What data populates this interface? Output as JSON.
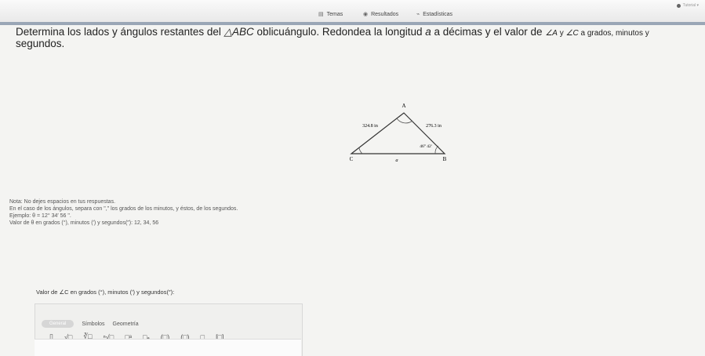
{
  "nav": {
    "temas": "Temas",
    "resultados": "Resultados",
    "estadisticas": "Estadísticas",
    "user": "Tutorial ▾"
  },
  "question": {
    "line1_a": "Determina los lados y ángulos restantes del ",
    "triangle_name": "△ABC",
    "line1_b": " oblicuángulo. Redondea la longitud ",
    "var_a": "a",
    "line1_c": " a décimas y el valor de ",
    "angle_a": "∠A",
    "line1_d": " y ",
    "angle_c": "∠C",
    "line1_e": " a grados, minutos y",
    "line2": "segundos."
  },
  "diagram": {
    "vertex_a": "A",
    "vertex_b": "B",
    "vertex_c": "C",
    "side_ac": "324.8 in",
    "side_ab": "276.3 in",
    "side_cb": "a",
    "angle_b": "46° 42'"
  },
  "note": {
    "line1": "Nota: No dejes espacios en tus respuestas.",
    "line2": "En el caso de los ángulos, separa con \",\" los grados de los minutos, y éstos, de los segundos.",
    "line3": "Ejemplo: θ = 12° 34′ 56 \".",
    "line4": "Valor de θ en grados (°), minutos (′) y segundos(″): 12, 34, 56"
  },
  "answer": {
    "label": "Valor de ∠C en grados (°), minutos (′) y segundos(″):"
  },
  "toolbar": {
    "tab_active": "General",
    "tab_symbols": "Símbolos",
    "tab_geometry": "Geometría",
    "symbols": [
      "▯",
      "√□",
      "∛□",
      "ⁿ√□",
      "□ᵃ",
      "□ₐ",
      "(□)",
      "(□)",
      "□",
      "[□]"
    ]
  }
}
